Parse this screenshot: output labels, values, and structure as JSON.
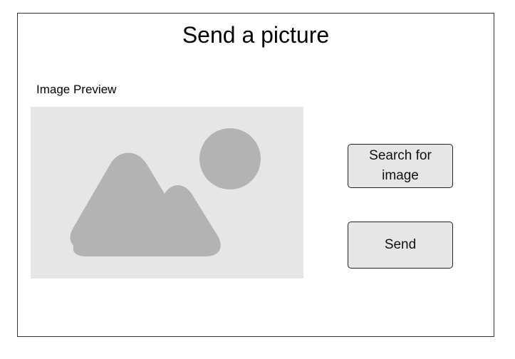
{
  "page": {
    "title": "Send a picture"
  },
  "preview": {
    "label": "Image Preview",
    "icon": "image-placeholder-icon"
  },
  "actions": {
    "search_label": "Search for image",
    "send_label": "Send"
  },
  "colors": {
    "preview_background": "#e6e6e6",
    "placeholder_shape": "#b3b3b3",
    "button_background": "#e6e6e6",
    "border": "#333333"
  }
}
